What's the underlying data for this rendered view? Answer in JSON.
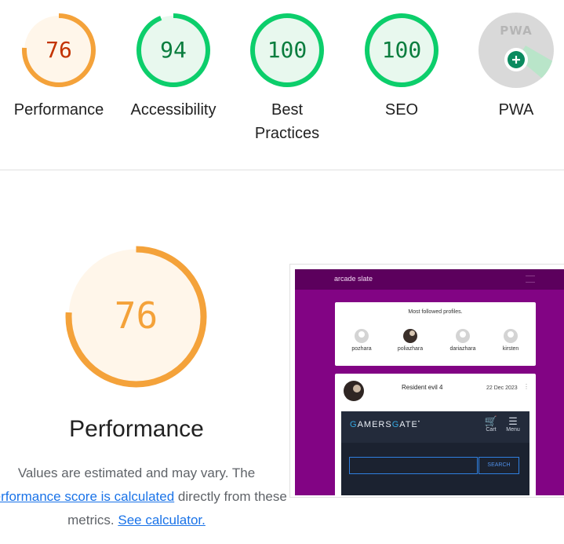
{
  "summary_gauges": [
    {
      "score": "76",
      "label_line1": "Performance",
      "label_line2": "",
      "fraction": 0.76,
      "color": "#f4a23a",
      "bg": "#fff6ea",
      "text_color": "#c33300"
    },
    {
      "score": "94",
      "label_line1": "Accessibility",
      "label_line2": "",
      "fraction": 0.94,
      "color": "#0cce6b",
      "bg": "#e8f8ee",
      "text_color": "#0a7d3e"
    },
    {
      "score": "100",
      "label_line1": "Best",
      "label_line2": "Practices",
      "fraction": 1.0,
      "color": "#0cce6b",
      "bg": "#e8f8ee",
      "text_color": "#0a7d3e"
    },
    {
      "score": "100",
      "label_line1": "SEO",
      "label_line2": "",
      "fraction": 1.0,
      "color": "#0cce6b",
      "bg": "#e8f8ee",
      "text_color": "#0a7d3e"
    }
  ],
  "pwa": {
    "badge_text": "PWA",
    "label": "PWA"
  },
  "performance": {
    "score": "76",
    "fraction": 0.76,
    "title": "Performance",
    "desc_line1": "Values are estimated and may vary. The",
    "desc_link1": "performance score is calculated",
    "desc_mid": " directly from these",
    "desc_line3_pre": "metrics. ",
    "desc_link2": "See calculator."
  },
  "screenshot": {
    "brand": "arcade slate",
    "profiles_title": "Most followed profiles.",
    "profiles": [
      {
        "name": "pozhara",
        "photo": false
      },
      {
        "name": "poliazhara",
        "photo": true
      },
      {
        "name": "dariazhara",
        "photo": false
      },
      {
        "name": "kirsten",
        "photo": false
      }
    ],
    "post_title": "Resident evil 4",
    "post_date": "22 Dec 2023",
    "post_menu": "⋮",
    "gg_logo_part1": "G",
    "gg_logo_part2": "AMERS",
    "gg_logo_part3": "G",
    "gg_logo_part4": "ATE",
    "gg_logo_mark": "•",
    "gg_cart": "Cart",
    "gg_menu": "Menu",
    "gg_search": "SEARCH"
  }
}
